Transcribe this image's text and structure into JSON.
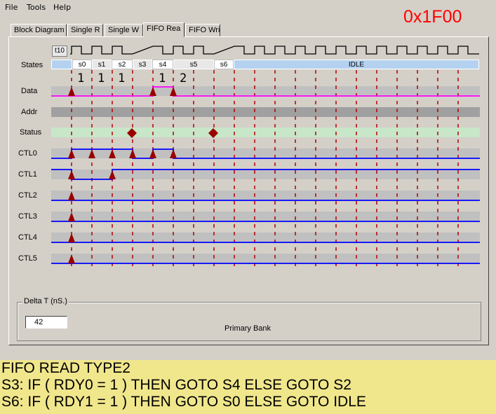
{
  "menu": {
    "file": "File",
    "tools": "Tools",
    "help": "Help"
  },
  "address": "0x1F00",
  "tabs": [
    "Block Diagram",
    "Single R",
    "Single W",
    "FIFO Rea",
    "FIFO Wri"
  ],
  "active_tab": "FIFO Rea",
  "timeline_label": "t10",
  "signals": [
    "States",
    "Data",
    "Addr",
    "Status",
    "CTL0",
    "CTL1",
    "CTL2",
    "CTL3",
    "CTL4",
    "CTL5"
  ],
  "states": [
    "s0",
    "s1",
    "s2",
    "s3",
    "s4",
    "s5",
    "s6",
    "IDLE"
  ],
  "tick_counts": [
    "1",
    "1",
    "1",
    "1",
    "2"
  ],
  "delta_t": {
    "title": "Delta T (nS.)",
    "value": "42"
  },
  "primary_bank": "Primary Bank",
  "description": {
    "line1": "FIFO READ TYPE2",
    "line2": "S3: IF ( RDY0 = 1 ) THEN GOTO S4 ELSE GOTO S2",
    "line3": "S6: IF ( RDY1 = 1 ) THEN GOTO S0 ELSE GOTO IDLE"
  },
  "colors": {
    "address": "#ff0000",
    "data_line": "#ff00ff",
    "ctl_line": "#0000ff",
    "status_track": "#c8e6c8",
    "state_idle": "#b4d2f0",
    "marker": "#990000",
    "footer_bg": "#f0e68c"
  }
}
